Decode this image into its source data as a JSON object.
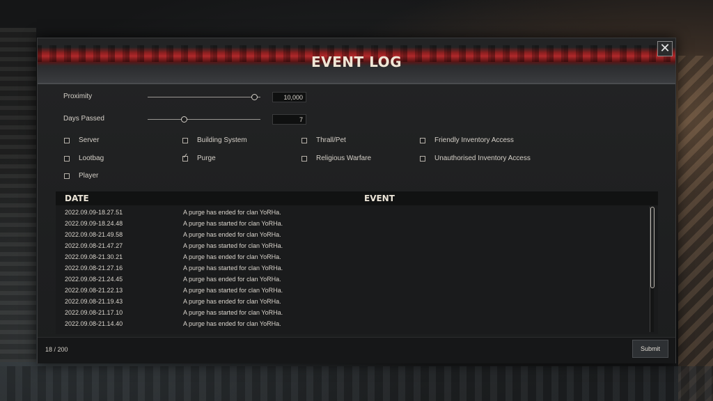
{
  "window": {
    "title": "EVENT LOG",
    "close_icon": "close-icon",
    "close_glyph": "✕"
  },
  "sliders": [
    {
      "label": "Proximity",
      "value": "10,000",
      "level": 0.95
    },
    {
      "label": "Days Passed",
      "value": "7",
      "level": 0.33
    }
  ],
  "filters": [
    {
      "label": "Server",
      "checked": false
    },
    {
      "label": "Building System",
      "checked": false
    },
    {
      "label": "Thrall/Pet",
      "checked": false
    },
    {
      "label": "Friendly Inventory Access",
      "checked": false
    },
    {
      "label": "Lootbag",
      "checked": false
    },
    {
      "label": "Purge",
      "checked": true
    },
    {
      "label": "Religious Warfare",
      "checked": false
    },
    {
      "label": "Unauthorised Inventory Access",
      "checked": false
    },
    {
      "label": "Player",
      "checked": false
    }
  ],
  "table": {
    "headers": {
      "date": "DATE",
      "event": "EVENT"
    },
    "rows": [
      {
        "date": "2022.09.09-18.27.51",
        "event": "A purge has ended for clan YoRHa."
      },
      {
        "date": "2022.09.09-18.24.48",
        "event": "A purge has started for clan YoRHa."
      },
      {
        "date": "2022.09.08-21.49.58",
        "event": "A purge has ended for clan YoRHa."
      },
      {
        "date": "2022.09.08-21.47.27",
        "event": "A purge has started for clan YoRHa."
      },
      {
        "date": "2022.09.08-21.30.21",
        "event": "A purge has ended for clan YoRHa."
      },
      {
        "date": "2022.09.08-21.27.16",
        "event": "A purge has started for clan YoRHa."
      },
      {
        "date": "2022.09.08-21.24.45",
        "event": "A purge has ended for clan YoRHa."
      },
      {
        "date": "2022.09.08-21.22.13",
        "event": "A purge has started for clan YoRHa."
      },
      {
        "date": "2022.09.08-21.19.43",
        "event": "A purge has ended for clan YoRHa."
      },
      {
        "date": "2022.09.08-21.17.10",
        "event": "A purge has started for clan YoRHa."
      },
      {
        "date": "2022.09.08-21.14.40",
        "event": "A purge has ended for clan YoRHa."
      }
    ]
  },
  "footer": {
    "count": "18 / 200",
    "submit_label": "Submit"
  },
  "colors": {
    "header_red": "#b0282a",
    "panel_bg": "#1f2021",
    "text": "#d9d4cc"
  }
}
